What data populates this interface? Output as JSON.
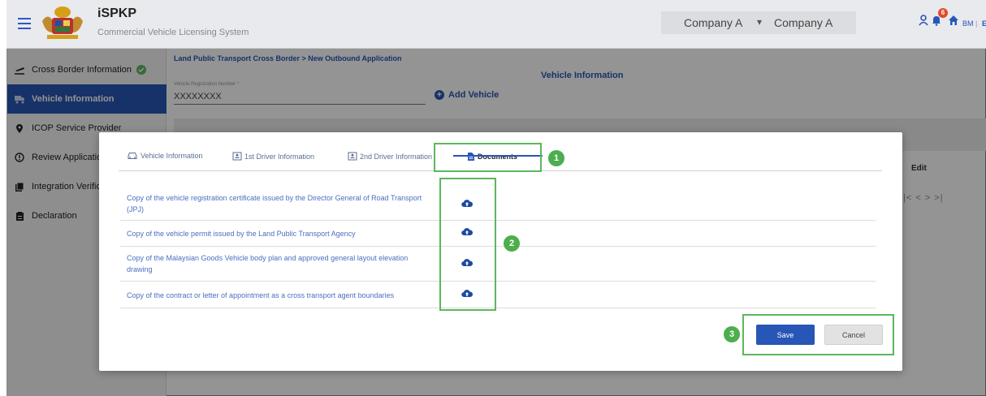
{
  "header": {
    "app_title": "iSPKP",
    "app_subtitle": "Commercial Vehicle Licensing System",
    "company_primary": "Company A",
    "company_secondary": "Company A",
    "notification_count": "6",
    "lang_bm": "BM",
    "lang_separator": "|",
    "lang_en": "EN"
  },
  "sidebar": {
    "items": [
      {
        "label": "Cross Border Information",
        "icon": "plane-departure-icon",
        "completed": true
      },
      {
        "label": "Vehicle Information",
        "icon": "truck-icon",
        "active": true
      },
      {
        "label": "ICOP Service Provider",
        "icon": "map-pin-icon"
      },
      {
        "label": "Review Application",
        "icon": "info-circle-icon"
      },
      {
        "label": "Integration Verification",
        "icon": "documents-icon"
      },
      {
        "label": "Declaration",
        "icon": "clipboard-icon"
      }
    ]
  },
  "main": {
    "breadcrumb": "Land Public Transport Cross Border > New Outbound Application",
    "page_title": "Vehicle Information",
    "vehicle_reg_label": "Vehicle Registration Number *",
    "vehicle_reg_value": "XXXXXXXX",
    "add_vehicle_label": "Add Vehicle",
    "table_edit_header": "Edit",
    "pager_glyphs": "|<  <  >  >|"
  },
  "modal": {
    "tabs": [
      {
        "label": "Vehicle Information",
        "icon": "car-icon"
      },
      {
        "label": "1st Driver Information",
        "icon": "id-card-icon"
      },
      {
        "label": "2nd Driver Information",
        "icon": "id-card-icon"
      },
      {
        "label": "Documents",
        "icon": "file-icon",
        "active": true
      }
    ],
    "documents": [
      {
        "label": "Copy of the vehicle registration certificate issued by the Director General of Road Transport (JPJ)"
      },
      {
        "label": "Copy of the vehicle permit issued by the Land Public Transport Agency"
      },
      {
        "label": "Copy of the Malaysian Goods Vehicle body plan and approved general layout elevation drawing"
      },
      {
        "label": "Copy of the contract or letter of appointment as a cross transport agent boundaries"
      }
    ],
    "save_label": "Save",
    "cancel_label": "Cancel"
  },
  "annotations": {
    "step_1": "1",
    "step_2": "2",
    "step_3": "3",
    "highlight_color": "#5cb85c"
  },
  "colors": {
    "primary": "#2856b6",
    "header_bg": "#e9eaee",
    "notification": "#e34a2a",
    "success": "#5cb85c"
  }
}
